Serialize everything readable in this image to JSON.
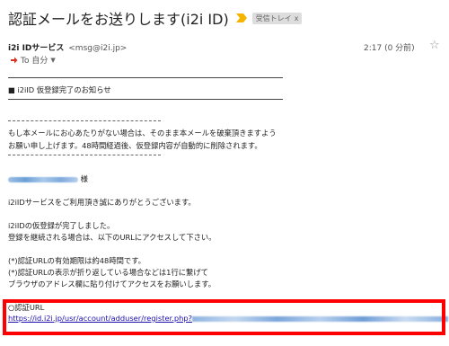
{
  "header": {
    "subject": "認証メールをお送りします(i2i ID)",
    "label": "受信トレイ",
    "label_close": "x"
  },
  "sender": {
    "name": "i2i IDサービス",
    "email": "<msg@i2i.jp>",
    "recipient": "To 自分",
    "time": "2:17 (0 分前)"
  },
  "message": {
    "section_title": "■ i2iID 仮登録完了のお知らせ",
    "notice_line1": "もし本メールにお心あたりがない場合は、そのまま本メールを破棄頂きますよう",
    "notice_line2": "お願い申し上げます。48時間経過後、仮登録内容が自動的に削除されます。",
    "salutation_suffix": "様",
    "thanks": "i2iIDサービスをご利用頂き誠にありがとうございます。",
    "done_line1": "i2iIDの仮登録が完了しました。",
    "done_line2": "登録を継続される場合は、以下のURLにアクセスして下さい。",
    "note_line1": "(*)認証URLの有効期限は約48時間です。",
    "note_line2": "(*)認証URLの表示が折り返している場合などは1行に繋げて",
    "note_line3": "ブラウザのアドレス欄に貼り付けてアクセスをお願いします。",
    "url_label": "○認証URL",
    "url": "https://id.i2i.jp/usr/account/adduser/register.php?"
  },
  "colors": {
    "highlight": "#ff0000",
    "link": "#1a0dab",
    "important_marker": "#f4b400"
  }
}
